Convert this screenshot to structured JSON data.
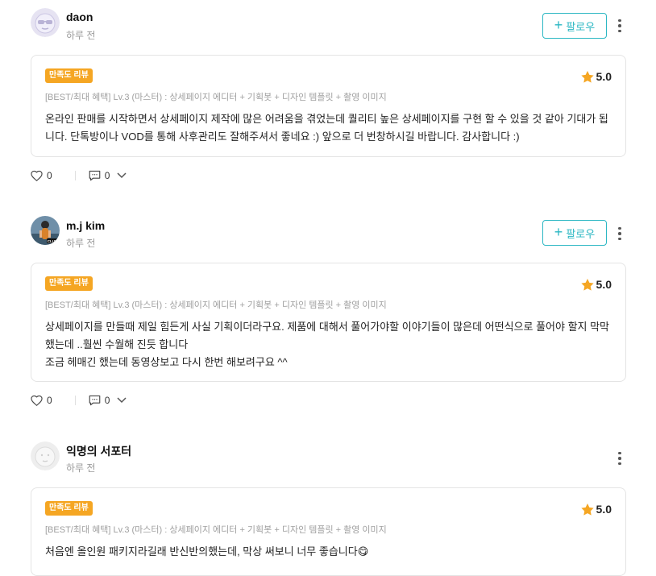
{
  "colors": {
    "accent": "#2bb7c3",
    "badge": "#f5a623",
    "star": "#f5a623"
  },
  "reviews": [
    {
      "name": "daon",
      "time": "하루 전",
      "follow_label": "팔로우",
      "badge": "만족도 리뷰",
      "rating": "5.0",
      "option": "[BEST/최대 혜택] Lv.3 (마스터) : 상세페이지 에디터 + 기획봇 + 디자인 템플릿 + 촬영 이미지",
      "text_lines": [
        "온라인 판매를 시작하면서 상세페이지 제작에 많은 어려움을 겪었는데 퀄리티 높은 상세페이지를 구현 할 수 있을 것 같아 기대가 됩니다. 단톡방이나 VOD를 통해 사후관리도 잘해주셔서 좋네요 :) 앞으로 더 번창하시길 바랍니다. 감사합니다 :)"
      ],
      "likes": "0",
      "comments": "0",
      "avatar_icon": "sunglasses-face-icon"
    },
    {
      "name": "m.j kim",
      "time": "하루 전",
      "follow_label": "팔로우",
      "badge": "만족도 리뷰",
      "rating": "5.0",
      "option": "[BEST/최대 혜택] Lv.3 (마스터) : 상세페이지 에디터 + 기획봇 + 디자인 템플릿 + 촬영 이미지",
      "text_lines": [
        "상세페이지를 만들때 제일 힘든게 사실 기획이더라구요. 제품에 대해서 풀어가야할 이야기들이 많은데 어떤식으로 풀어야 할지 막막했는데 ..훨씬 수월해 진듯 합니다",
        "조금 헤매긴 했는데 동영상보고 다시 한번 해보려구요 ^^"
      ],
      "likes": "0",
      "comments": "0",
      "avatar_label": "CLUB"
    },
    {
      "name": "익명의 서포터",
      "time": "하루 전",
      "badge": "만족도 리뷰",
      "rating": "5.0",
      "option": "[BEST/최대 혜택] Lv.3 (마스터) : 상세페이지 에디터 + 기획봇 + 디자인 템플릿 + 촬영 이미지",
      "text_lines": [
        "처음엔 올인원 패키지라길래 반신반의했는데, 막상 써보니 너무 좋습니다😋"
      ],
      "avatar_icon": "anonymous-face-icon"
    }
  ]
}
